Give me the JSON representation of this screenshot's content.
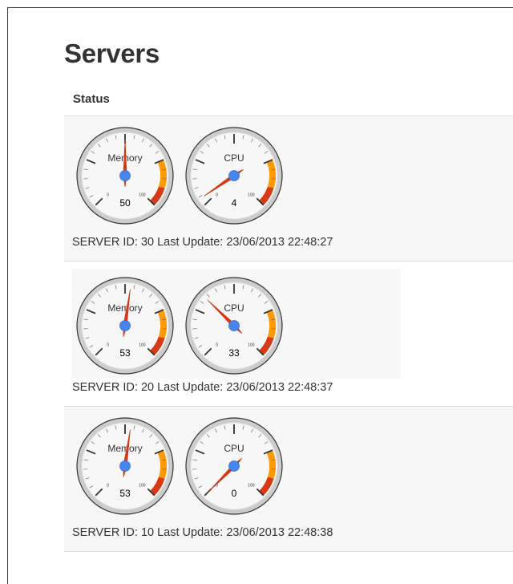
{
  "page": {
    "title": "Servers",
    "column_header": "Status"
  },
  "gauge_config": {
    "min": 0,
    "max": 100,
    "min_label": "0",
    "max_label": "100"
  },
  "servers": [
    {
      "server_line": "SERVER ID: 30 Last Update: 23/06/2013 22:48:27",
      "memory": {
        "label": "Memory",
        "value": 50
      },
      "cpu": {
        "label": "CPU",
        "value": 4
      }
    },
    {
      "server_line": "SERVER ID: 20 Last Update: 23/06/2013 22:48:37",
      "memory": {
        "label": "Memory",
        "value": 53
      },
      "cpu": {
        "label": "CPU",
        "value": 33
      }
    },
    {
      "server_line": "SERVER ID: 10 Last Update: 23/06/2013 22:48:38",
      "memory": {
        "label": "Memory",
        "value": 53
      },
      "cpu": {
        "label": "CPU",
        "value": 0
      }
    }
  ],
  "colors": {
    "needle": "#dc3912",
    "hub": "#4684ee",
    "yellow_band": "#ff9900",
    "red_band": "#dc3912",
    "row_stripe": "#f7f7f7"
  }
}
